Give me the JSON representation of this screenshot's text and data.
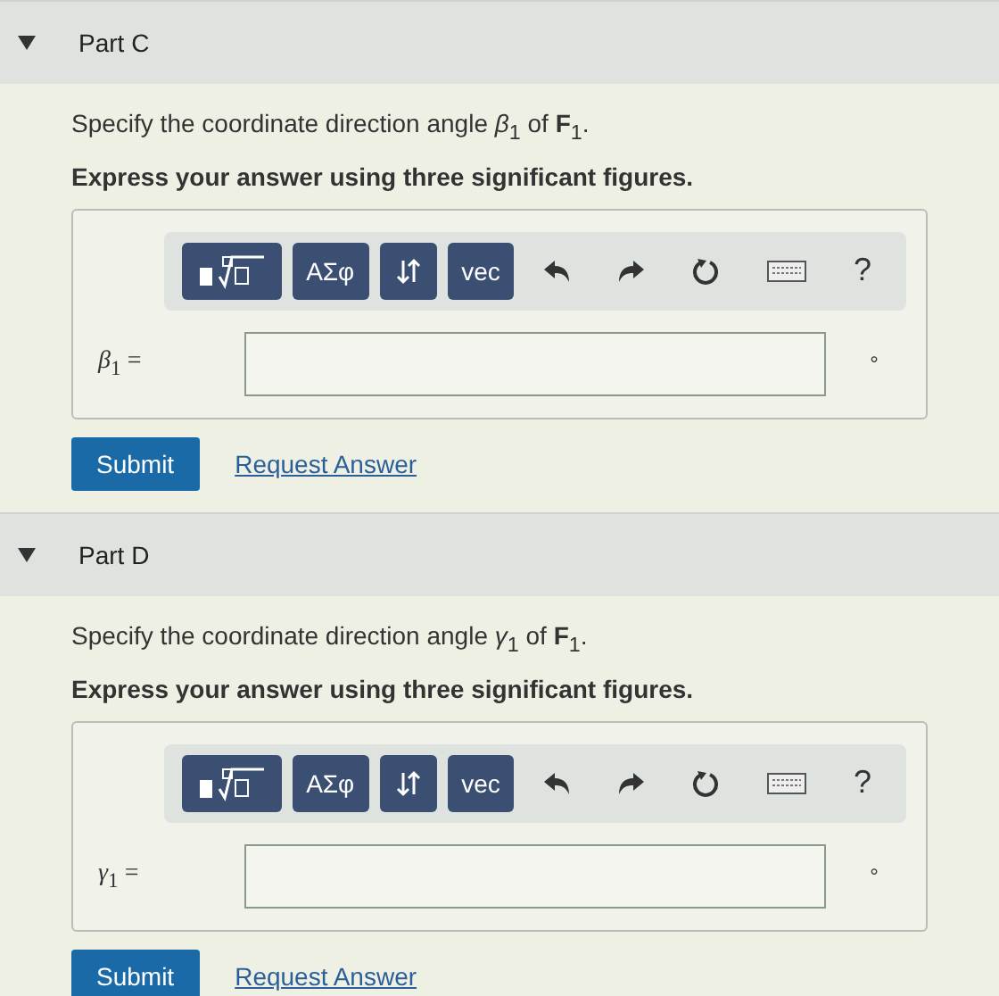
{
  "parts": [
    {
      "title": "Part C",
      "expanded": true,
      "prompt": "Specify the coordinate direction angle *β*$_{1}$ of **F**$_{1}$.",
      "instruction": "Express your answer using three significant figures.",
      "toolbar": [
        "ΑΣφ",
        "vec",
        "?"
      ],
      "label": "*β*$_{1}$ =",
      "unit": "°",
      "submit": "Submit",
      "request": "Request Answer"
    },
    {
      "title": "Part D",
      "expanded": true,
      "prompt": "Specify the coordinate direction angle *γ*$_{1}$ of **F**$_{1}$.",
      "instruction": "Express your answer using three significant figures.",
      "toolbar": [
        "ΑΣφ",
        "vec",
        "?"
      ],
      "label": "*γ*$_{1}$ =",
      "unit": "°",
      "submit": "Submit",
      "request": "Request Answer"
    }
  ]
}
